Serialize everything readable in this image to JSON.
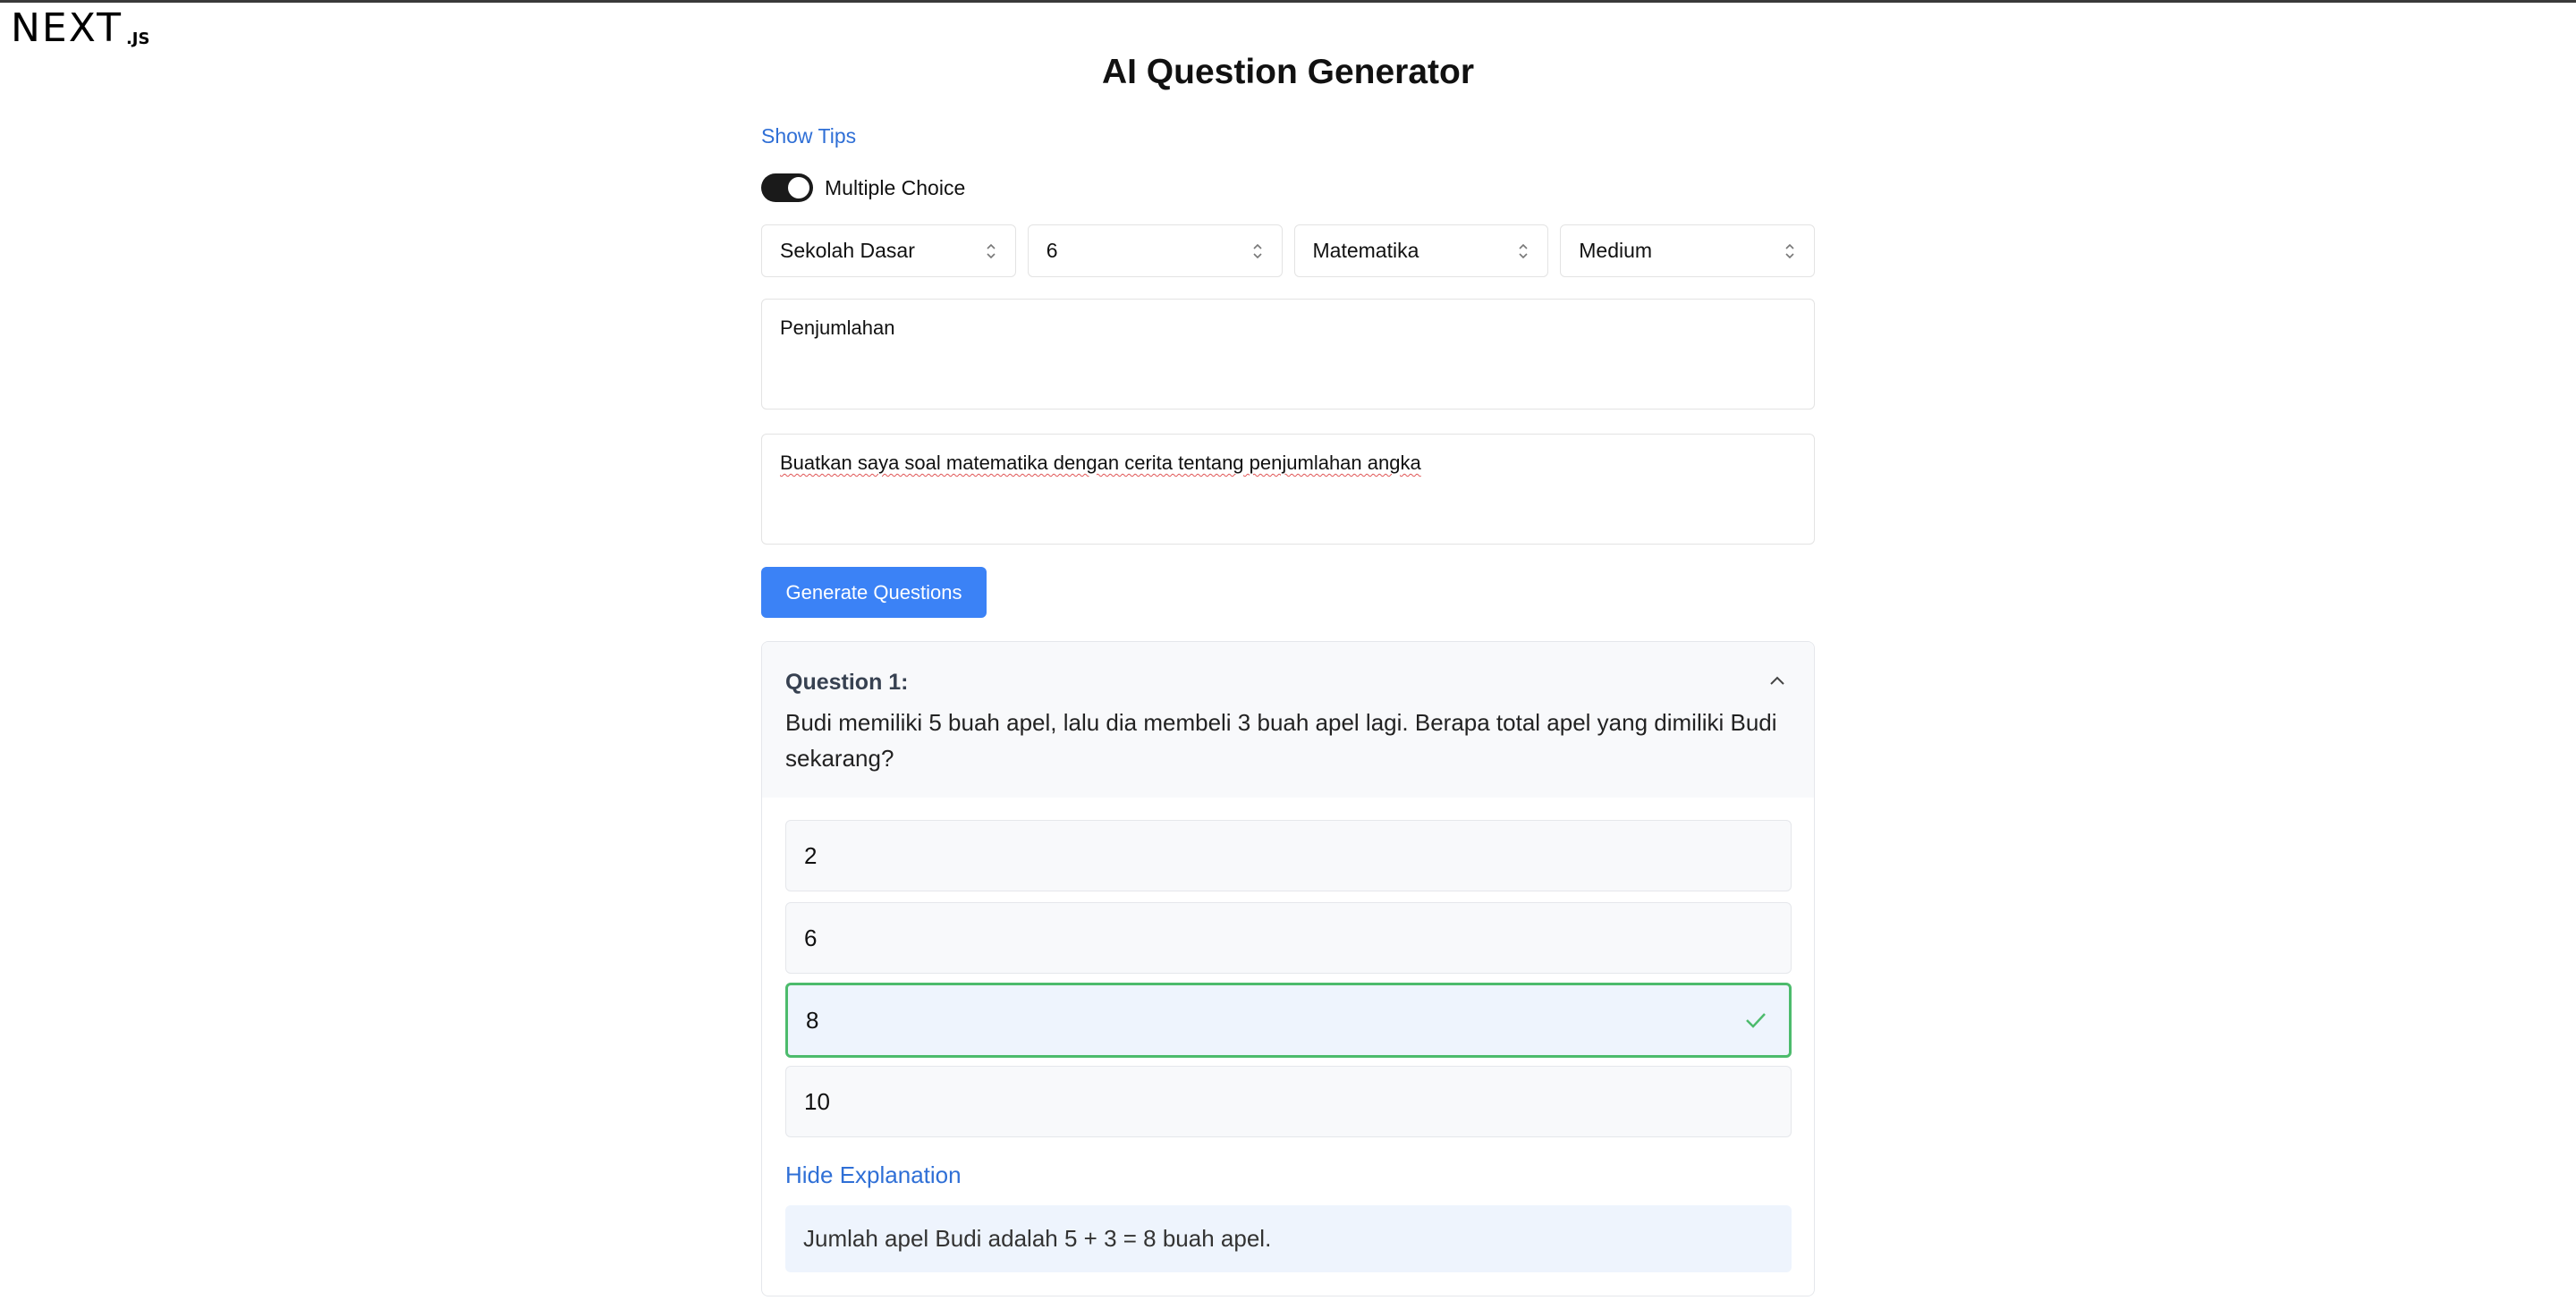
{
  "logo": {
    "main": "NEXT",
    "suffix": ".JS"
  },
  "page": {
    "title": "AI Question Generator"
  },
  "controls": {
    "show_tips": "Show Tips",
    "toggle_label": "Multiple Choice",
    "toggle_on": true,
    "selects": [
      {
        "value": "Sekolah Dasar"
      },
      {
        "value": "6"
      },
      {
        "value": "Matematika"
      },
      {
        "value": "Medium"
      }
    ],
    "topic": "Penjumlahan",
    "prompt": "Buatkan saya soal matematika dengan cerita tentang penjumlahan angka",
    "generate_button": "Generate Questions"
  },
  "question": {
    "label": "Question 1:",
    "text": "Budi memiliki 5 buah apel, lalu dia membeli 3 buah apel lagi. Berapa total apel yang dimiliki Budi sekarang?",
    "options": [
      {
        "text": "2",
        "correct": false
      },
      {
        "text": "6",
        "correct": false
      },
      {
        "text": "8",
        "correct": true
      },
      {
        "text": "10",
        "correct": false
      }
    ],
    "hide_explanation": "Hide Explanation",
    "explanation": "Jumlah apel Budi adalah 5 + 3 = 8 buah apel.",
    "colors": {
      "correct_border": "#4cbb6c",
      "accent": "#3b82f6",
      "link": "#2f6fd6"
    }
  }
}
